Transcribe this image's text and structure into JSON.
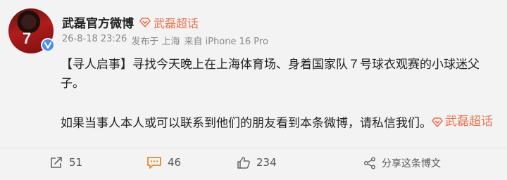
{
  "post": {
    "author": "武磊官方微博",
    "supertopic_label": "武磊超话",
    "timestamp": "26-8-18 23:26",
    "location": "发布于 上海",
    "source": "来自 iPhone 16 Pro",
    "avatar_jersey": "7",
    "content": {
      "line1": "【寻人启事】寻找今天晚上在上海体育场、身着国家队７号球衣观赛的小球迷父子。",
      "line2": "如果当事人本人或可以联系到他们的朋友看到本条微博，请私信我们。",
      "inline_topic": "武磊超话"
    }
  },
  "actions": {
    "forward_count": "51",
    "comment_count": "46",
    "like_count": "234",
    "share_label": "分享这条博文"
  },
  "colors": {
    "accent": "#eb7350",
    "verified": "#4b8fe8",
    "background": "#f3f3f3"
  },
  "icons": {
    "forward": "forward-icon",
    "comment": "comment-icon",
    "like": "like-icon",
    "share": "share-icon",
    "supertopic": "diamond-icon",
    "verified": "verified-v-icon"
  }
}
